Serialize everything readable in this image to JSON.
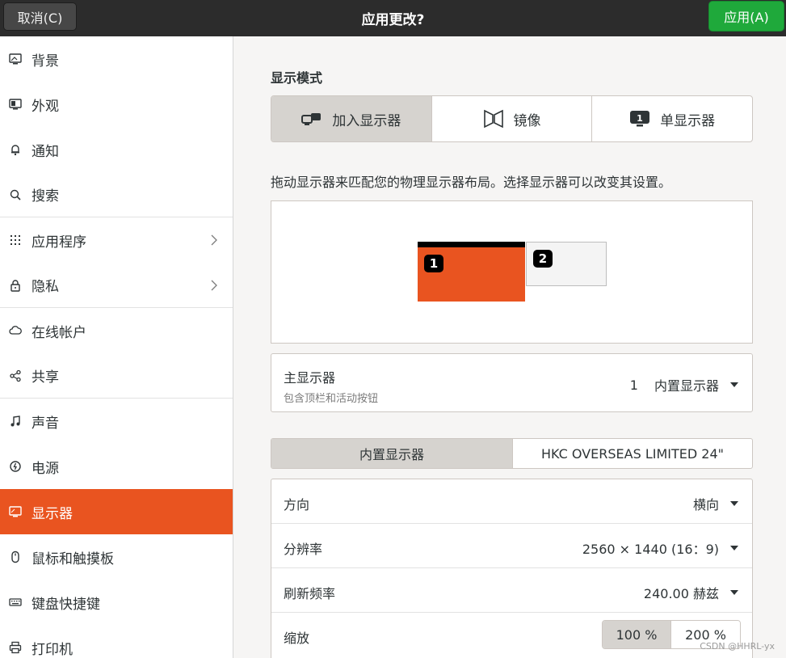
{
  "header": {
    "title": "应用更改?",
    "cancel_label": "取消(C)",
    "apply_label": "应用(A)",
    "apply_color": "#1fa93b"
  },
  "sidebar": {
    "items": [
      {
        "label": "背景",
        "icon": "background-icon"
      },
      {
        "label": "外观",
        "icon": "appearance-icon"
      },
      {
        "label": "通知",
        "icon": "bell-icon"
      },
      {
        "label": "搜索",
        "icon": "search-icon"
      },
      {
        "label": "应用程序",
        "icon": "apps-grid-icon",
        "has_submenu": true
      },
      {
        "label": "隐私",
        "icon": "lock-icon",
        "has_submenu": true
      },
      {
        "label": "在线帐户",
        "icon": "cloud-icon"
      },
      {
        "label": "共享",
        "icon": "share-icon"
      },
      {
        "label": "声音",
        "icon": "music-note-icon"
      },
      {
        "label": "电源",
        "icon": "power-icon"
      },
      {
        "label": "显示器",
        "icon": "display-icon",
        "active": true
      },
      {
        "label": "鼠标和触摸板",
        "icon": "mouse-icon"
      },
      {
        "label": "键盘快捷键",
        "icon": "keyboard-icon"
      },
      {
        "label": "打印机",
        "icon": "printer-icon"
      }
    ],
    "active_color": "#e95420"
  },
  "main": {
    "section_title": "显示模式",
    "modes": [
      {
        "label": "加入显示器",
        "icon": "join-displays-icon",
        "active": true
      },
      {
        "label": "镜像",
        "icon": "mirror-icon"
      },
      {
        "label": "单显示器",
        "icon": "single-display-icon"
      }
    ],
    "hint": "拖动显示器来匹配您的物理显示器布局。选择显示器可以改变其设置。",
    "monitors": [
      {
        "number": "1",
        "color": "#e95420"
      },
      {
        "number": "2",
        "color": "#f4f4f4"
      }
    ],
    "primary": {
      "title": "主显示器",
      "subtitle": "包含顶栏和活动按钮",
      "number": "1",
      "value": "内置显示器"
    },
    "tabs": [
      "内置显示器",
      "HKC OVERSEAS LIMITED 24\""
    ],
    "settings": {
      "orientation": {
        "label": "方向",
        "value": "横向"
      },
      "resolution": {
        "label": "分辨率",
        "value": "2560 × 1440 (16：9)"
      },
      "refresh": {
        "label": "刷新频率",
        "value": "240.00 赫兹"
      },
      "scale": {
        "label": "缩放",
        "options": [
          "100 %",
          "200 %"
        ],
        "selected": "100 %"
      }
    }
  },
  "watermark": "CSDN @HHRL-yx"
}
